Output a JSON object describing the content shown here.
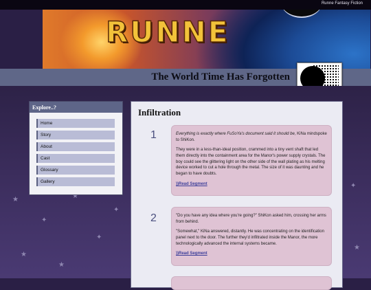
{
  "header": {
    "site_name": "Runne Fantasy Fiction",
    "banner_title": "RUNNE",
    "subtitle": "The World Time Has Forgotten"
  },
  "sidebar": {
    "heading": "Explore..?",
    "items": [
      {
        "label": "Home"
      },
      {
        "label": "Story"
      },
      {
        "label": "About"
      },
      {
        "label": "Cast"
      },
      {
        "label": "Glossary"
      },
      {
        "label": "Gallery"
      }
    ]
  },
  "main": {
    "title": "Infiltration",
    "segments": [
      {
        "number": "1",
        "p1_italic": "Everything is exactly where FuSoYa's document said it should be,",
        "p1_rest": " KiNa mindspoke to ShiKon.",
        "p2": "They were in a less-than-ideal position, crammed into a tiny vent shaft that led them directly into the containment area for the Manor's power supply crystals. The boy could see the glittering light on the other side of the wall plating as his melting device worked to cut a hole through the metal. The size of it was daunting and he began to have doubts.",
        "link": "))Read Segment"
      },
      {
        "number": "2",
        "p1": "\"Do you have any idea where you're going?\" ShiKon asked him, crossing her arms from behind.",
        "p2": "\"Somewhat,\" KiNa answered, distantly. He was concentrating on the identification panel next to the door. The further they'd infiltrated inside the Manor, the more technologically advanced the internal systems became.",
        "link": "))Read Segment"
      }
    ]
  }
}
